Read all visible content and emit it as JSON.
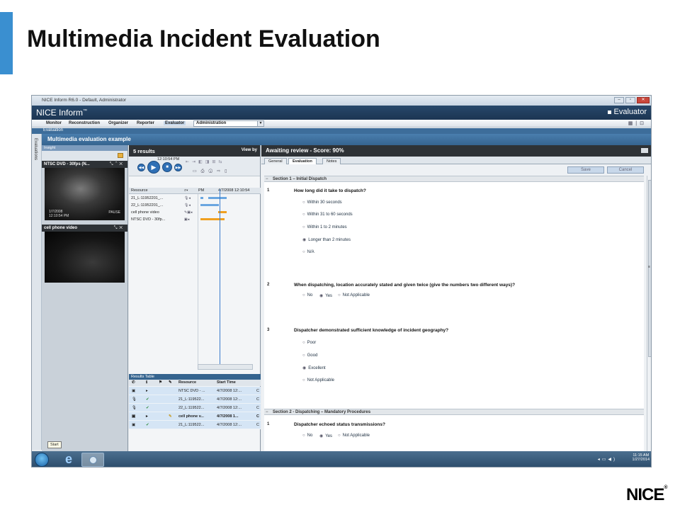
{
  "slide": {
    "title": "Multimedia Incident Evaluation",
    "logo_text": "NICE",
    "accent_color": "#3a8fd0"
  },
  "window": {
    "title": "NICE Inform R6.0 - Default, Administrator",
    "brand": "NICE Inform",
    "brand_tm": "™",
    "module": "Evaluator"
  },
  "menu": {
    "items": [
      "Monitor",
      "Reconstruction",
      "Organizer",
      "Reporter",
      "Evaluator"
    ],
    "admin": "Administration"
  },
  "breadcrumb": "Evaluation",
  "sidebar_tab": "Evaluations",
  "evaluation_title": "Multimedia evaluation example",
  "insight": {
    "header": "Insight",
    "video1": {
      "title": "NTSC DVD - 30fps (N...",
      "date": "1/7/2008",
      "time": "12:10:54 PM",
      "status": "PAUSE"
    },
    "video2": {
      "title": "cell phone video"
    }
  },
  "player": {
    "results_label": "5 results",
    "view_by": "View by",
    "time": "12:10:54 PM",
    "timeline_header": {
      "resource": "Resource",
      "pm": "PM",
      "timestamp": "4/7/2008 12:10:54"
    },
    "timeline_rows": [
      "21_L:11952201_...",
      "22_L:11952201_...",
      "cell phone video",
      "NTSC DVD - 30fp..."
    ]
  },
  "results_table": {
    "title": "Results Table",
    "columns": {
      "resource": "Resource",
      "start_time": "Start Time"
    },
    "rows": [
      {
        "resource": "NTSC DVD - ...",
        "start": "4/7/2008 12:...",
        "extra": "C"
      },
      {
        "resource": "21_L:119522...",
        "start": "4/7/2008 12:...",
        "extra": "C"
      },
      {
        "resource": "22_L:119522...",
        "start": "4/7/2008 12:...",
        "extra": "C"
      },
      {
        "resource": "cell phone v...",
        "start": "4/7/2008 1...",
        "extra": "C"
      },
      {
        "resource": "21_L:119522...",
        "start": "4/7/2008 12:...",
        "extra": "C"
      }
    ]
  },
  "eval": {
    "status": "Awaiting review - Score: 90%",
    "tabs": [
      "General",
      "Evaluation",
      "Notes"
    ],
    "save": "Save",
    "cancel": "Cancel",
    "section1": "Section 1 – Initial Dispatch",
    "q1": {
      "num": "1",
      "text": "How long did it take to dispatch?",
      "options": [
        "Within 30 seconds",
        "Within 31 to 60 seconds",
        "Within 1 to 2 minutes",
        "Longer than 2 minutes",
        "N/A"
      ]
    },
    "q2": {
      "num": "2",
      "text": "When dispatching, location accurately stated and given twice (give the numbers two different ways)?",
      "options": [
        "No",
        "Yes",
        "Not Applicable"
      ]
    },
    "q3": {
      "num": "3",
      "text": "Dispatcher demonstrated sufficient knowledge of incident geography?",
      "options": [
        "Poor",
        "Good",
        "Excellent",
        "Not Applicable"
      ]
    },
    "section2": "Section 2 - Dispatching – Mandatory Procedures",
    "q4": {
      "num": "1",
      "text": "Dispatcher echoed status transmissions?",
      "options": [
        "No",
        "Yes",
        "Not Applicable"
      ]
    }
  },
  "taskbar": {
    "start_tip": "Start",
    "time": "11:15 AM",
    "date": "1/27/2014"
  }
}
